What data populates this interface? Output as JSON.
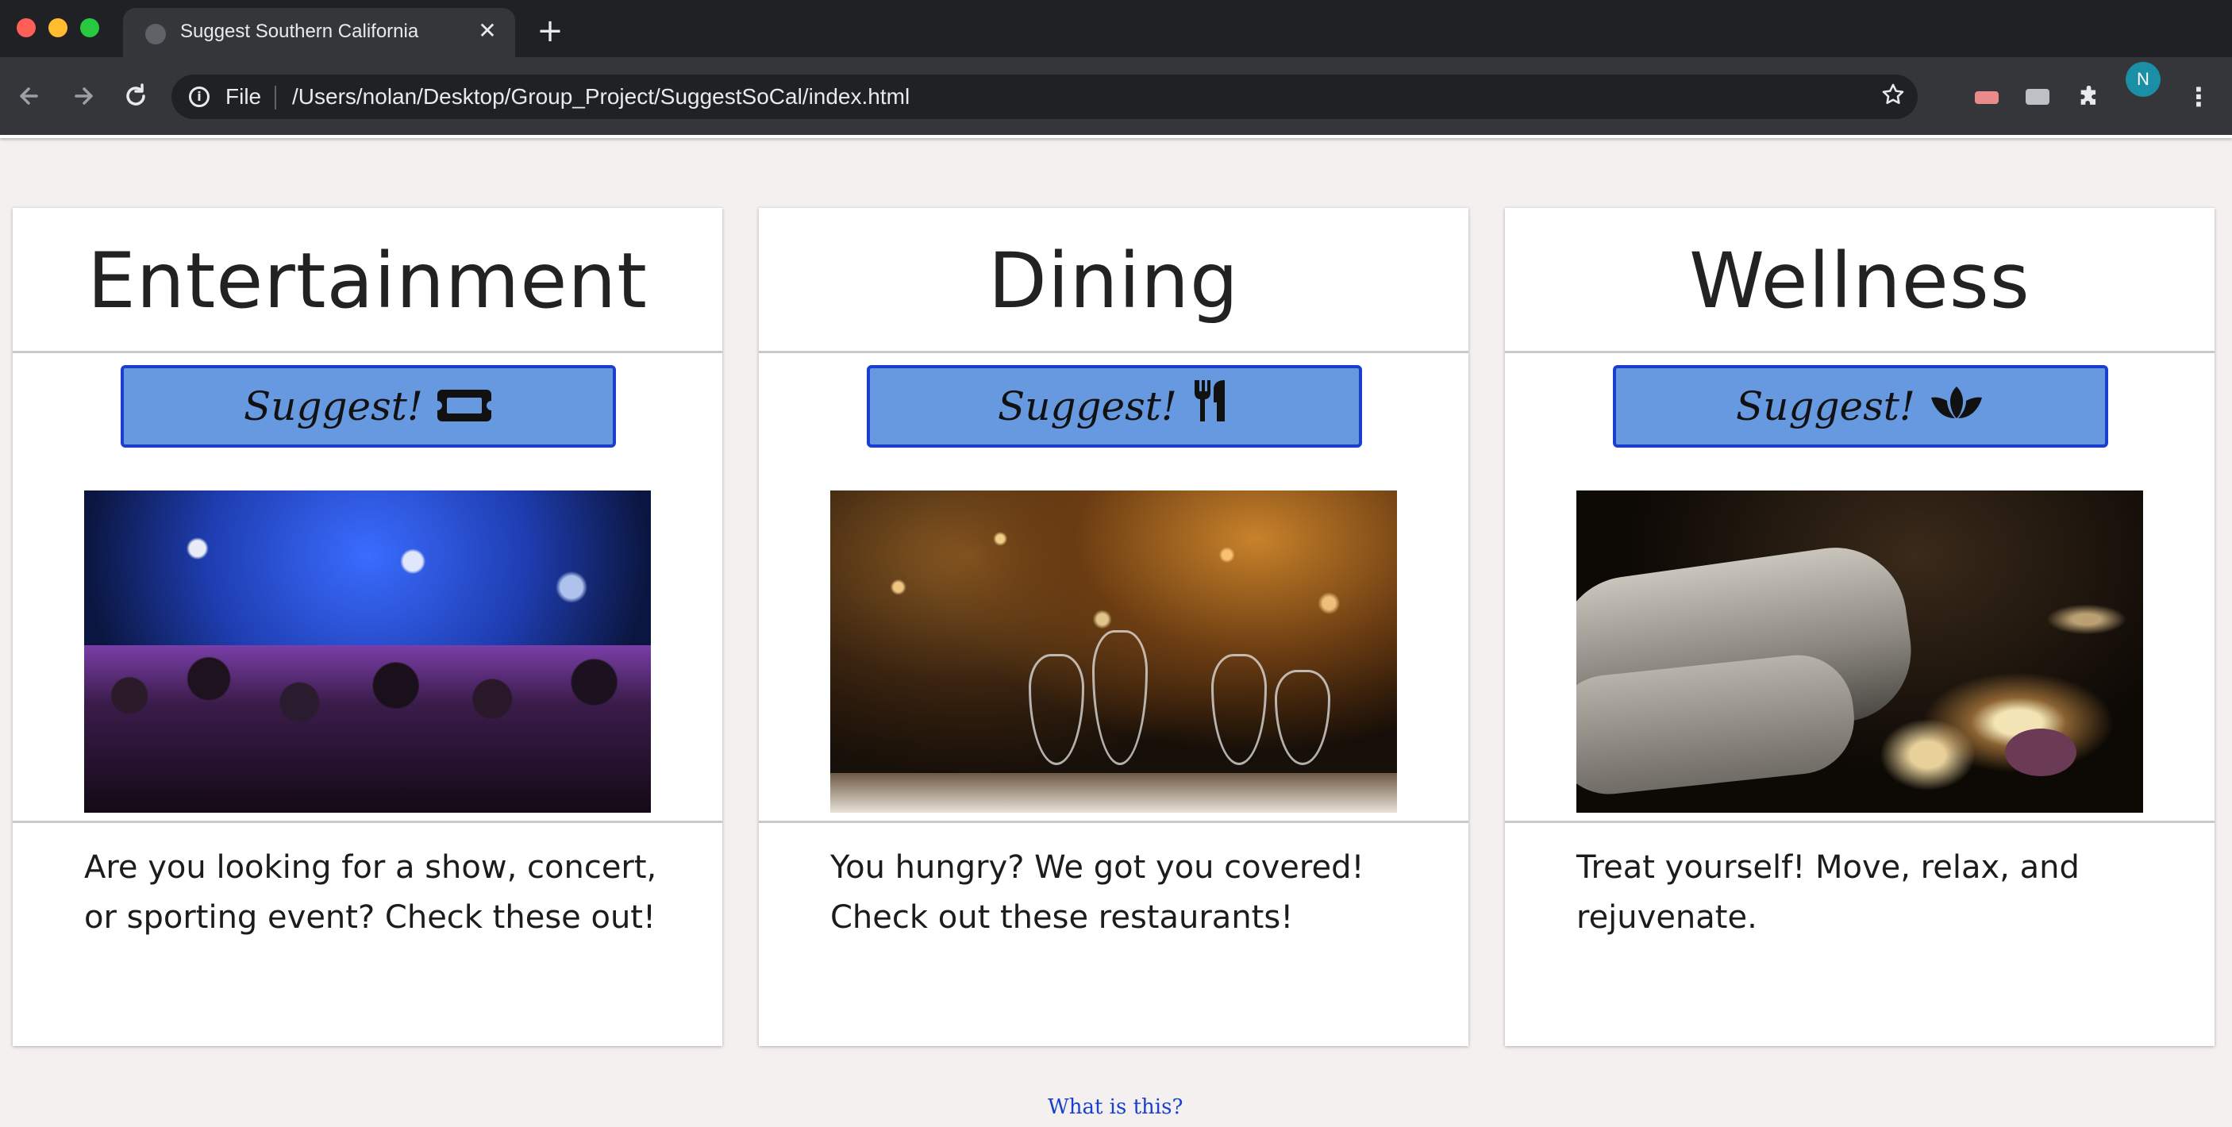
{
  "browser": {
    "tab_title": "Suggest Southern California",
    "tab_close": "✕",
    "new_tab": "+",
    "scheme_label": "File",
    "url": "/Users/nolan/Desktop/Group_Project/SuggestSoCal/index.html",
    "profile_initial": "N",
    "icons": [
      "back-arrow-icon",
      "forward-arrow-icon",
      "reload-icon",
      "info-icon",
      "star-icon",
      "extension-icon",
      "puzzle-icon",
      "kebab-menu-icon"
    ]
  },
  "cards": [
    {
      "title": "Entertainment",
      "button_label": "Suggest!",
      "button_icon": "ticket-icon",
      "description": "Are you looking for a show, concert, or sporting event? Check these out!"
    },
    {
      "title": "Dining",
      "button_label": "Suggest!",
      "button_icon": "utensils-icon",
      "description": "You hungry? We got you covered! Check out these restaurants!"
    },
    {
      "title": "Wellness",
      "button_label": "Suggest!",
      "button_icon": "lotus-icon",
      "description": "Treat yourself! Move, relax, and rejuvenate."
    }
  ],
  "footer": {
    "link_text": "What is this?"
  },
  "colors": {
    "button_fill": "#6699e0",
    "button_border": "#1a3fcf",
    "link": "#1a3fcf",
    "page_background": "#f3f0ef"
  }
}
